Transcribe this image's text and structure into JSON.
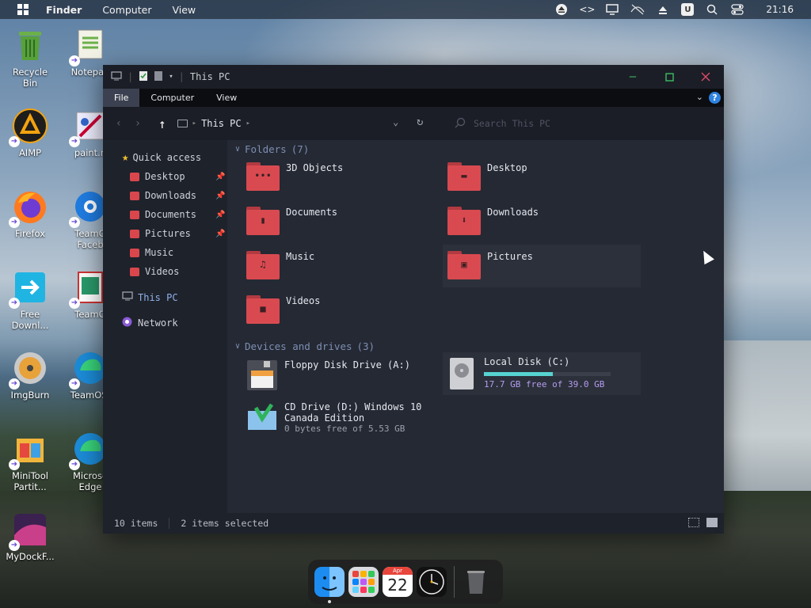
{
  "topbar": {
    "app": "Finder",
    "menus": [
      "Computer",
      "View"
    ],
    "clock": "21:16",
    "tray_icons": [
      "eject-icon",
      "code-icon",
      "monitor-icon",
      "network-off-icon",
      "upload-icon",
      "u-box-icon",
      "search-icon",
      "control-center-icon"
    ],
    "tray_box_label": "U"
  },
  "desktop": {
    "icons": [
      {
        "label": "Recycle\nBin",
        "icon": "recycle-bin-icon"
      },
      {
        "label": "Notepad",
        "icon": "notepad-icon"
      },
      {
        "label": "AIMP",
        "icon": "aimp-icon"
      },
      {
        "label": "paint.n",
        "icon": "paint-icon"
      },
      {
        "label": "Firefox",
        "icon": "firefox-icon"
      },
      {
        "label": "TeamO\nFaceb",
        "icon": "teamos-facebook-icon"
      },
      {
        "label": "Free\nDownl...",
        "icon": "free-download-icon"
      },
      {
        "label": "TeamO",
        "icon": "teamos-icon"
      },
      {
        "label": "ImgBurn",
        "icon": "imgburn-icon"
      },
      {
        "label": "TeamOS.",
        "icon": "teamos-edge-icon"
      },
      {
        "label": "MiniTool\nPartit...",
        "icon": "minitool-icon"
      },
      {
        "label": "Microso\nEdge",
        "icon": "edge-icon"
      },
      {
        "label": "MyDockF...",
        "icon": "mydockfinder-icon"
      }
    ]
  },
  "window": {
    "title": "This PC",
    "ribbon_tabs": [
      "File",
      "Computer",
      "View"
    ],
    "active_tab": "File",
    "help": "?",
    "address": {
      "crumb": "This PC",
      "search_placeholder": "Search This PC"
    },
    "sidebar": {
      "quick_access": "Quick access",
      "items": [
        {
          "label": "Desktop",
          "pinned": true
        },
        {
          "label": "Downloads",
          "pinned": true
        },
        {
          "label": "Documents",
          "pinned": true
        },
        {
          "label": "Pictures",
          "pinned": true
        },
        {
          "label": "Music",
          "pinned": false
        },
        {
          "label": "Videos",
          "pinned": false
        }
      ],
      "this_pc": "This PC",
      "network": "Network"
    },
    "folders_header": "Folders",
    "folders_count": "(7)",
    "folders": [
      {
        "label": "3D Objects",
        "glyph": "•••"
      },
      {
        "label": "Desktop",
        "glyph": "▬"
      },
      {
        "label": "Documents",
        "glyph": "▮"
      },
      {
        "label": "Downloads",
        "glyph": "⬇"
      },
      {
        "label": "Music",
        "glyph": "♫"
      },
      {
        "label": "Pictures",
        "glyph": "▣"
      },
      {
        "label": "Videos",
        "glyph": "■"
      }
    ],
    "drives_header": "Devices and drives",
    "drives_count": "(3)",
    "drives": [
      {
        "label": "Floppy Disk Drive (A:)",
        "sub": ""
      },
      {
        "label": "Local Disk (C:)",
        "sub": "17.7 GB free of 39.0 GB",
        "used_fraction": 0.546
      },
      {
        "label": "CD Drive (D:) Windows 10\nCanada Edition",
        "sub": "0 bytes free of 5.53 GB"
      }
    ],
    "status": {
      "items": "10 items",
      "selected": "2 items selected"
    }
  },
  "colors": {
    "accent": "#d94a50",
    "header": "#7d8fb3",
    "disk_bar": "#57d3d0",
    "free_text": "#b59cf0"
  },
  "dock": {
    "apps": [
      "finder-icon",
      "launchpad-icon",
      "calendar-icon",
      "clock-icon",
      "trash-icon"
    ],
    "calendar_month": "Apr",
    "calendar_day": "22"
  }
}
